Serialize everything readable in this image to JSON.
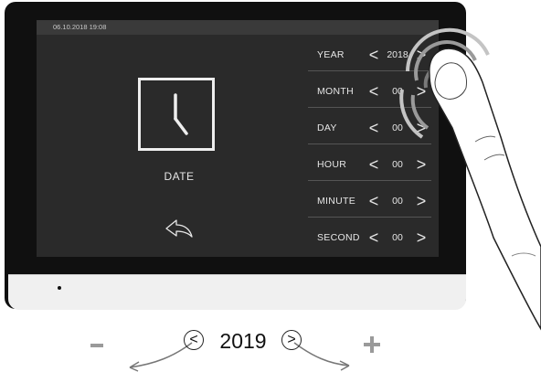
{
  "status_bar": {
    "text": "06.10.2018  19:08"
  },
  "main": {
    "date_label": "DATE",
    "clock_icon": "clock-icon",
    "back_icon": "back-arrow-icon"
  },
  "settings": {
    "prev_glyph": "<",
    "next_glyph": ">",
    "rows": [
      {
        "label": "YEAR",
        "value": "2018"
      },
      {
        "label": "MONTH",
        "value": "00"
      },
      {
        "label": "DAY",
        "value": "00"
      },
      {
        "label": "HOUR",
        "value": "00"
      },
      {
        "label": "MINUTE",
        "value": "00"
      },
      {
        "label": "SECOND",
        "value": "00"
      }
    ]
  },
  "caption": {
    "minus": "-",
    "prev": "<",
    "year": "2019",
    "next": ">",
    "plus": "+"
  },
  "colors": {
    "screen_bg": "#2a2a2a",
    "text": "#e6e6e6",
    "bezel": "#101010"
  }
}
